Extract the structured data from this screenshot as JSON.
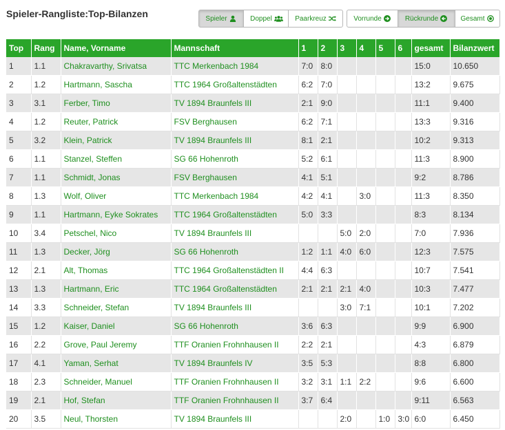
{
  "title": "Spieler-Rangliste:Top-Bilanzen",
  "view_buttons": [
    {
      "label": "Spieler",
      "icon": "user-icon",
      "active": true
    },
    {
      "label": "Doppel",
      "icon": "users-icon",
      "active": false
    },
    {
      "label": "Paarkreuz",
      "icon": "shuffle-icon",
      "active": false
    }
  ],
  "round_buttons": [
    {
      "label": "Vorrunde",
      "icon": "circle-arrow-right-icon",
      "active": false
    },
    {
      "label": "Rückrunde",
      "icon": "circle-arrow-left-icon",
      "active": true
    },
    {
      "label": "Gesamt",
      "icon": "circle-dot-icon",
      "active": false
    }
  ],
  "colors": {
    "accent": "#2aa52a",
    "link": "#1f8f1f",
    "row_alt": "#e6e6e6"
  },
  "table": {
    "headers": [
      "Top",
      "Rang",
      "Name, Vorname",
      "Mannschaft",
      "1",
      "2",
      "3",
      "4",
      "5",
      "6",
      "gesamt",
      "Bilanzwert"
    ],
    "rows": [
      [
        "1",
        "1.1",
        "Chakravarthy, Srivatsa",
        "TTC Merkenbach 1984",
        "7:0",
        "8:0",
        "",
        "",
        "",
        "",
        "15:0",
        "10.650"
      ],
      [
        "2",
        "1.2",
        "Hartmann, Sascha",
        "TTC 1964 Großaltenstädten",
        "6:2",
        "7:0",
        "",
        "",
        "",
        "",
        "13:2",
        "9.675"
      ],
      [
        "3",
        "3.1",
        "Ferber, Timo",
        "TV 1894 Braunfels III",
        "2:1",
        "9:0",
        "",
        "",
        "",
        "",
        "11:1",
        "9.400"
      ],
      [
        "4",
        "1.2",
        "Reuter, Patrick",
        "FSV Berghausen",
        "6:2",
        "7:1",
        "",
        "",
        "",
        "",
        "13:3",
        "9.316"
      ],
      [
        "5",
        "3.2",
        "Klein, Patrick",
        "TV 1894 Braunfels III",
        "8:1",
        "2:1",
        "",
        "",
        "",
        "",
        "10:2",
        "9.313"
      ],
      [
        "6",
        "1.1",
        "Stanzel, Steffen",
        "SG 66 Hohenroth",
        "5:2",
        "6:1",
        "",
        "",
        "",
        "",
        "11:3",
        "8.900"
      ],
      [
        "7",
        "1.1",
        "Schmidt, Jonas",
        "FSV Berghausen",
        "4:1",
        "5:1",
        "",
        "",
        "",
        "",
        "9:2",
        "8.786"
      ],
      [
        "8",
        "1.3",
        "Wolf, Oliver",
        "TTC Merkenbach 1984",
        "4:2",
        "4:1",
        "",
        "3:0",
        "",
        "",
        "11:3",
        "8.350"
      ],
      [
        "9",
        "1.1",
        "Hartmann, Eyke Sokrates",
        "TTC 1964 Großaltenstädten",
        "5:0",
        "3:3",
        "",
        "",
        "",
        "",
        "8:3",
        "8.134"
      ],
      [
        "10",
        "3.4",
        "Petschel, Nico",
        "TV 1894 Braunfels III",
        "",
        "",
        "5:0",
        "2:0",
        "",
        "",
        "7:0",
        "7.936"
      ],
      [
        "11",
        "1.3",
        "Decker, Jörg",
        "SG 66 Hohenroth",
        "1:2",
        "1:1",
        "4:0",
        "6:0",
        "",
        "",
        "12:3",
        "7.575"
      ],
      [
        "12",
        "2.1",
        "Alt, Thomas",
        "TTC 1964 Großaltenstädten II",
        "4:4",
        "6:3",
        "",
        "",
        "",
        "",
        "10:7",
        "7.541"
      ],
      [
        "13",
        "1.3",
        "Hartmann, Eric",
        "TTC 1964 Großaltenstädten",
        "2:1",
        "2:1",
        "2:1",
        "4:0",
        "",
        "",
        "10:3",
        "7.477"
      ],
      [
        "14",
        "3.3",
        "Schneider, Stefan",
        "TV 1894 Braunfels III",
        "",
        "",
        "3:0",
        "7:1",
        "",
        "",
        "10:1",
        "7.202"
      ],
      [
        "15",
        "1.2",
        "Kaiser, Daniel",
        "SG 66 Hohenroth",
        "3:6",
        "6:3",
        "",
        "",
        "",
        "",
        "9:9",
        "6.900"
      ],
      [
        "16",
        "2.2",
        "Grove, Paul Jeremy",
        "TTF Oranien Frohnhausen II",
        "2:2",
        "2:1",
        "",
        "",
        "",
        "",
        "4:3",
        "6.879"
      ],
      [
        "17",
        "4.1",
        "Yaman, Serhat",
        "TV 1894 Braunfels IV",
        "3:5",
        "5:3",
        "",
        "",
        "",
        "",
        "8:8",
        "6.800"
      ],
      [
        "18",
        "2.3",
        "Schneider, Manuel",
        "TTF Oranien Frohnhausen II",
        "3:2",
        "3:1",
        "1:1",
        "2:2",
        "",
        "",
        "9:6",
        "6.600"
      ],
      [
        "19",
        "2.1",
        "Hof, Stefan",
        "TTF Oranien Frohnhausen II",
        "3:7",
        "6:4",
        "",
        "",
        "",
        "",
        "9:11",
        "6.563"
      ],
      [
        "20",
        "3.5",
        "Neul, Thorsten",
        "TV 1894 Braunfels III",
        "",
        "",
        "2:0",
        "",
        "1:0",
        "3:0",
        "6:0",
        "6.450"
      ]
    ]
  }
}
